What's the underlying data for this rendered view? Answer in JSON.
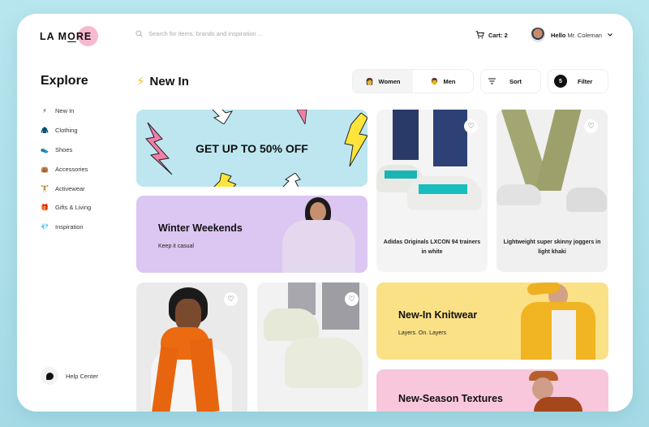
{
  "brand": {
    "name_a": "LA M",
    "name_o": "O",
    "name_b": "RE"
  },
  "search": {
    "placeholder": "Search for items, brands and inspiration ...",
    "icon": "search-icon"
  },
  "cart": {
    "label": "Cart: 2",
    "icon": "cart-icon"
  },
  "user": {
    "greeting": "Hello",
    "name": "Mr. Coleman"
  },
  "sidebar": {
    "title": "Explore",
    "items": [
      {
        "label": "New In",
        "icon": "⚡"
      },
      {
        "label": "Clothing",
        "icon": "🧥"
      },
      {
        "label": "Shoes",
        "icon": "👟"
      },
      {
        "label": "Accessories",
        "icon": "👜"
      },
      {
        "label": "Activewear",
        "icon": "🏋"
      },
      {
        "label": "Gifts & Living",
        "icon": "🎁"
      },
      {
        "label": "Inspiration",
        "icon": "💎"
      }
    ],
    "help": "Help Center"
  },
  "main": {
    "title": "New In",
    "title_icon": "⚡",
    "segments": [
      {
        "label": "Women",
        "icon": "👩",
        "active": true
      },
      {
        "label": "Men",
        "icon": "👨",
        "active": false
      }
    ],
    "sort": "Sort",
    "filter": {
      "label": "Filter",
      "count": "5"
    }
  },
  "cards": {
    "promo": "GET UP TO 50% OFF",
    "winter": {
      "title": "Winter Weekends",
      "subtitle": "Keep it casual"
    },
    "knit": {
      "title": "New-In Knitwear",
      "subtitle": "Layers. On. Layers"
    },
    "texture": {
      "title": "New-Season Textures"
    },
    "products": [
      {
        "title": "Adidas Originals LXCON 94 trainers in white"
      },
      {
        "title": "Lightweight super skinny joggers in light khaki"
      },
      {
        "title": ""
      },
      {
        "title": ""
      }
    ]
  },
  "colors": {
    "promo": "#bde6f0",
    "winter": "#dcc6f2",
    "knit": "#fbe186",
    "texture": "#f8c7dc",
    "accent": "#f7b9cf"
  }
}
